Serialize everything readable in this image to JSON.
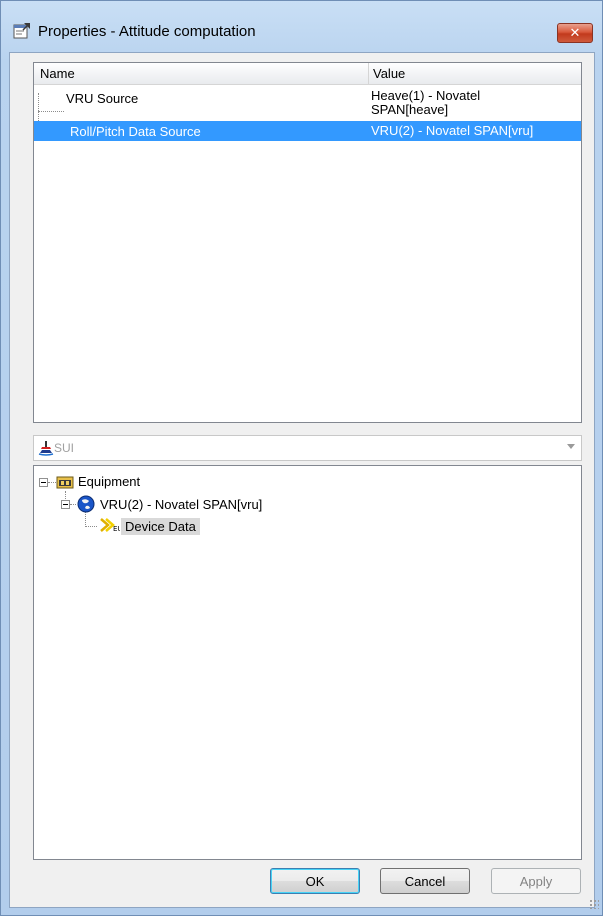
{
  "window": {
    "title": "Properties - Attitude computation",
    "close_glyph": "✕",
    "icon": "properties-window-icon"
  },
  "property_grid": {
    "columns": {
      "name": "Name",
      "value": "Value"
    },
    "rows": [
      {
        "name": "VRU Source",
        "value_line1": "Heave(1) - Novatel",
        "value_line2": "SPAN[heave]",
        "selected": false
      },
      {
        "name": "Roll/Pitch Data Source",
        "value_line1": "VRU(2) - Novatel SPAN[vru]",
        "value_line2": "",
        "selected": true
      }
    ],
    "selection_color": "#3399ff"
  },
  "source_combo": {
    "value": "SUI",
    "icon": "sui-icon"
  },
  "tree": {
    "root": {
      "label": "Equipment",
      "icon": "equipment-icon",
      "expanded": true
    },
    "child": {
      "label": "VRU(2) - Novatel SPAN[vru]",
      "icon": "globe-icon",
      "expanded": true
    },
    "leaf": {
      "label": "Device Data",
      "icon": "device-data-icon",
      "highlighted": true
    }
  },
  "buttons": {
    "ok": "OK",
    "cancel": "Cancel",
    "apply": "Apply"
  },
  "colors": {
    "title_bar": "#c9dff5",
    "close_button": "#c23a1d",
    "client_bg": "#f0f0f0"
  }
}
